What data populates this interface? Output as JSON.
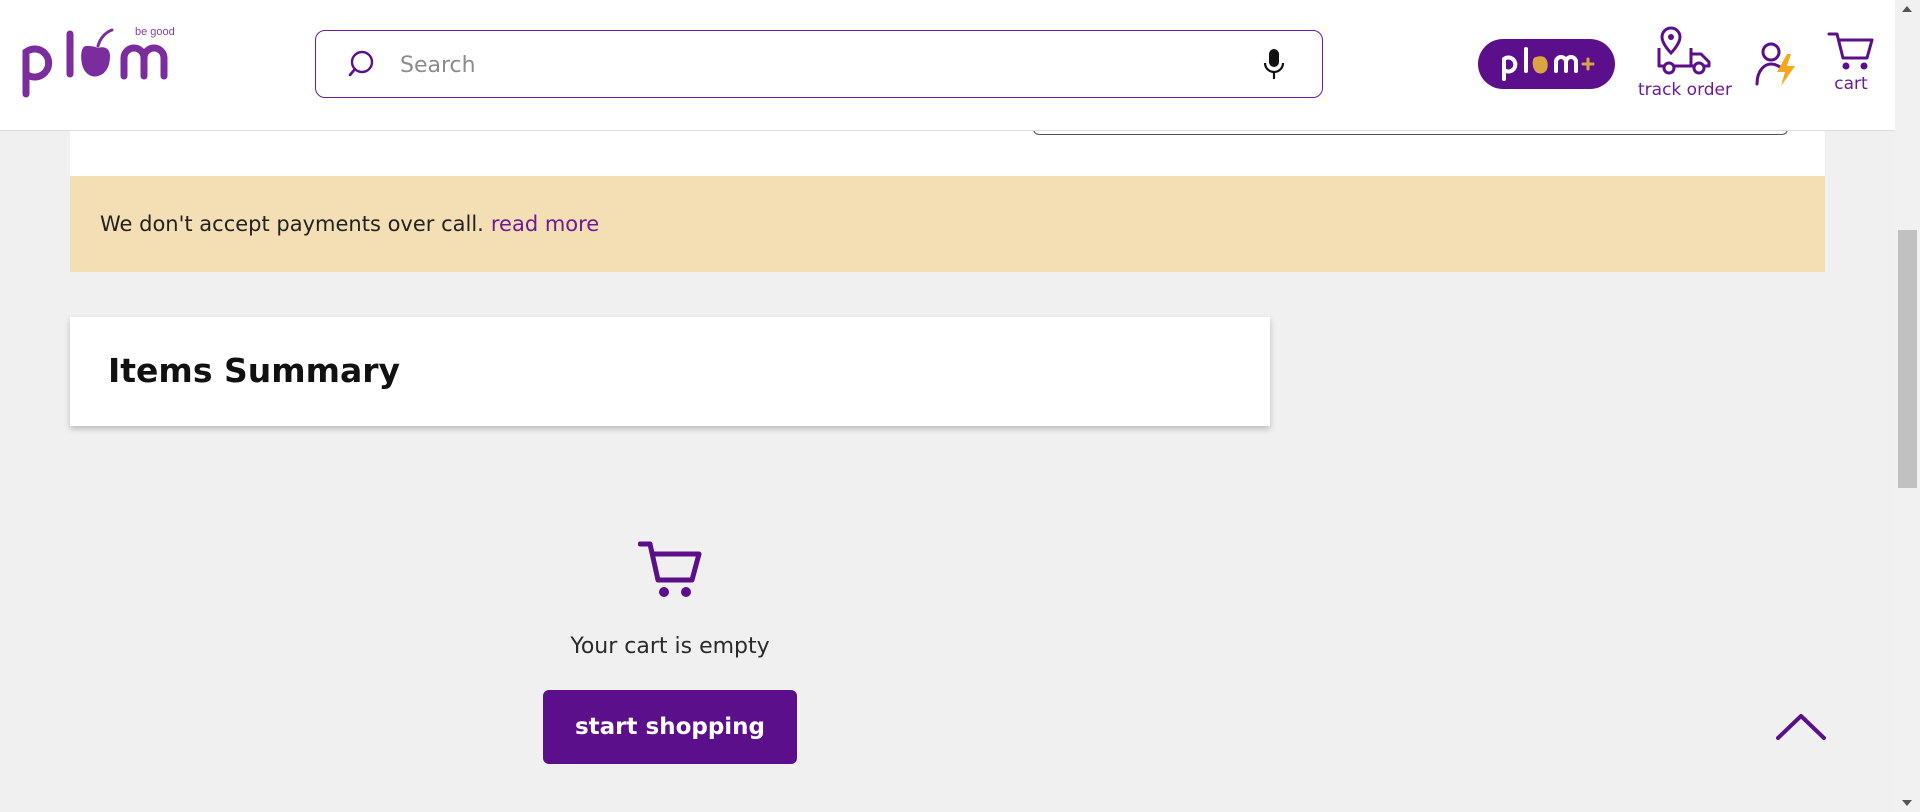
{
  "header": {
    "logo_text": "plum",
    "logo_tagline": "be good",
    "search_placeholder": "Search",
    "plum_plus_label": "plum+",
    "track_order_label": "track order",
    "cart_label": "cart"
  },
  "banner": {
    "text": "We don't accept payments over call.",
    "link_text": "read more"
  },
  "summary": {
    "title": "Items Summary"
  },
  "empty_cart": {
    "message": "Your cart is empty",
    "button_label": "start shopping"
  },
  "colors": {
    "brand": "#5c0f8a",
    "banner_bg": "#f4deb3",
    "page_bg": "#f0f0f0"
  },
  "icons": [
    "search-icon",
    "microphone-icon",
    "delivery-truck-icon",
    "account-icon",
    "cart-icon",
    "chevron-up-icon"
  ]
}
